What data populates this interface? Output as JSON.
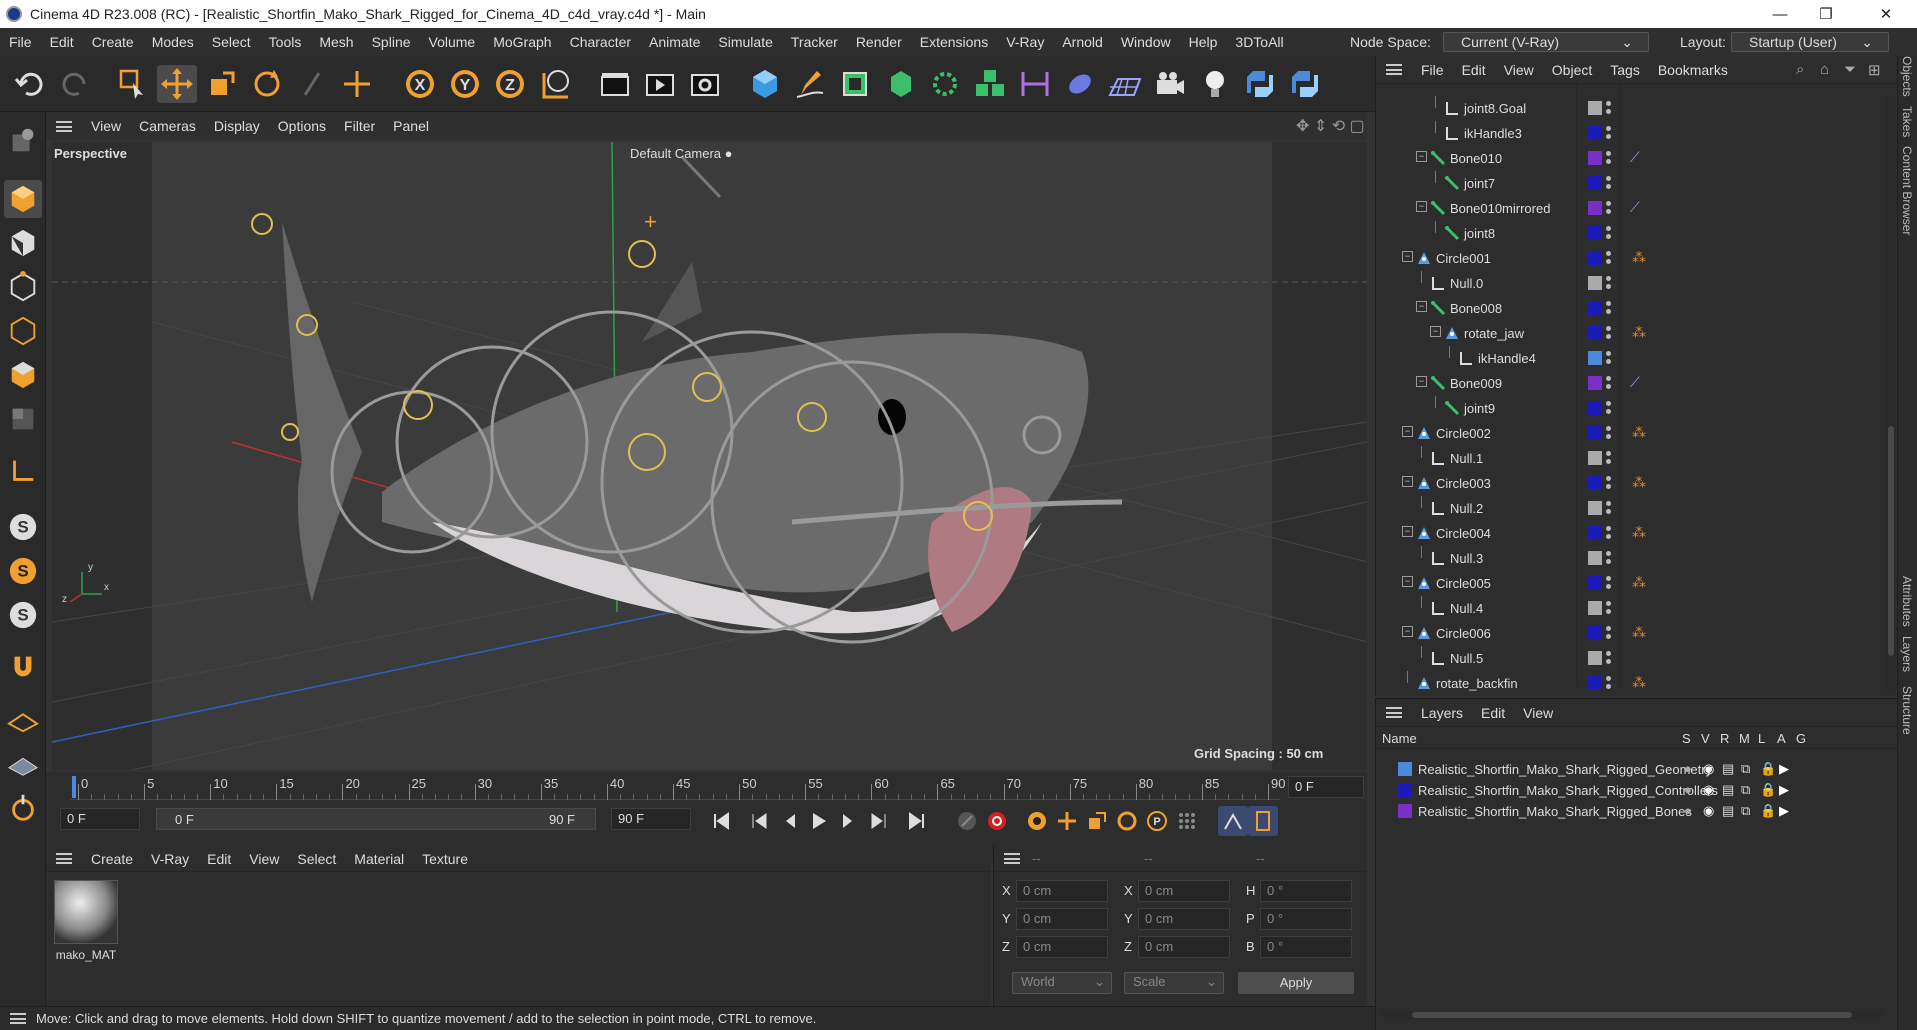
{
  "window": {
    "title": "Cinema 4D R23.008 (RC) - [Realistic_Shortfin_Mako_Shark_Rigged_for_Cinema_4D_c4d_vray.c4d *] - Main",
    "minimize": "—",
    "maximize": "❐",
    "close": "✕"
  },
  "menubar": {
    "items": [
      "File",
      "Edit",
      "Create",
      "Modes",
      "Select",
      "Tools",
      "Mesh",
      "Spline",
      "Volume",
      "MoGraph",
      "Character",
      "Animate",
      "Simulate",
      "Tracker",
      "Render",
      "Extensions",
      "V-Ray",
      "Arnold",
      "Window",
      "Help",
      "3DToAll"
    ],
    "node_space_label": "Node Space:",
    "node_space_value": "Current (V-Ray)",
    "layout_label": "Layout:",
    "layout_value": "Startup (User)"
  },
  "viewport": {
    "menu": [
      "View",
      "Cameras",
      "Display",
      "Options",
      "Filter",
      "Panel"
    ],
    "label": "Perspective",
    "camera": "Default Camera",
    "grid_spacing": "Grid Spacing : 50 cm",
    "axis_x": "x",
    "axis_y": "y",
    "axis_z": "z"
  },
  "timeline": {
    "ticks": [
      "0",
      "5",
      "10",
      "15",
      "20",
      "25",
      "30",
      "35",
      "40",
      "45",
      "50",
      "55",
      "60",
      "65",
      "70",
      "75",
      "80",
      "85",
      "90"
    ],
    "frame_display": "0 F",
    "start": "0 F",
    "range_start": "0 F",
    "range_end": "90 F",
    "end": "90 F"
  },
  "materials": {
    "menu": [
      "Create",
      "V-Ray",
      "Edit",
      "View",
      "Select",
      "Material",
      "Texture"
    ],
    "items": [
      {
        "name": "mako_MAT"
      }
    ]
  },
  "attributes": {
    "headers": [
      "--",
      "--",
      "--"
    ],
    "rows": [
      {
        "a": "X",
        "av": "0 cm",
        "b": "X",
        "bv": "0 cm",
        "c": "H",
        "cv": "0 °"
      },
      {
        "a": "Y",
        "av": "0 cm",
        "b": "Y",
        "bv": "0 cm",
        "c": "P",
        "cv": "0 °"
      },
      {
        "a": "Z",
        "av": "0 cm",
        "b": "Z",
        "bv": "0 cm",
        "c": "B",
        "cv": "0 °"
      }
    ],
    "coord_mode": "World",
    "size_mode": "Scale",
    "apply": "Apply"
  },
  "status": "Move: Click and drag to move elements. Hold down SHIFT to quantize movement / add to the selection in point mode, CTRL to remove.",
  "objects": {
    "menu": [
      "File",
      "Edit",
      "View",
      "Object",
      "Tags",
      "Bookmarks"
    ],
    "rows": [
      {
        "name": "joint8.Goal",
        "indent": 4,
        "kind": "null",
        "color": "#aaaaaa",
        "tag": "",
        "expander": false
      },
      {
        "name": "ikHandle3",
        "indent": 4,
        "kind": "null",
        "color": "#1a1ab8",
        "tag": "",
        "expander": false
      },
      {
        "name": "Bone010",
        "indent": 3,
        "kind": "bone",
        "color": "#7a2fc8",
        "tag": "ik",
        "expander": true
      },
      {
        "name": "joint7",
        "indent": 4,
        "kind": "bone",
        "color": "#1a1ab8",
        "tag": "",
        "expander": false
      },
      {
        "name": "Bone010mirrored",
        "indent": 3,
        "kind": "bone",
        "color": "#7a2fc8",
        "tag": "ik",
        "expander": true
      },
      {
        "name": "joint8",
        "indent": 4,
        "kind": "bone",
        "color": "#1a1ab8",
        "tag": "",
        "expander": false
      },
      {
        "name": "Circle001",
        "indent": 2,
        "kind": "spline",
        "color": "#1a1ab8",
        "tag": "xp",
        "expander": true
      },
      {
        "name": "Null.0",
        "indent": 3,
        "kind": "null",
        "color": "#aaaaaa",
        "tag": "",
        "expander": false
      },
      {
        "name": "Bone008",
        "indent": 3,
        "kind": "bone",
        "color": "#1a1ab8",
        "tag": "",
        "expander": true
      },
      {
        "name": "rotate_jaw",
        "indent": 4,
        "kind": "spline",
        "color": "#1a1ab8",
        "tag": "xp",
        "expander": true
      },
      {
        "name": "ikHandle4",
        "indent": 5,
        "kind": "null",
        "color": "#4a8ad8",
        "tag": "",
        "expander": false
      },
      {
        "name": "Bone009",
        "indent": 3,
        "kind": "bone",
        "color": "#7a2fc8",
        "tag": "ik2",
        "expander": true
      },
      {
        "name": "joint9",
        "indent": 4,
        "kind": "bone",
        "color": "#1a1ab8",
        "tag": "",
        "expander": false
      },
      {
        "name": "Circle002",
        "indent": 2,
        "kind": "spline",
        "color": "#1a1ab8",
        "tag": "xp",
        "expander": true
      },
      {
        "name": "Null.1",
        "indent": 3,
        "kind": "null",
        "color": "#aaaaaa",
        "tag": "",
        "expander": false
      },
      {
        "name": "Circle003",
        "indent": 2,
        "kind": "spline",
        "color": "#1a1ab8",
        "tag": "xp",
        "expander": true
      },
      {
        "name": "Null.2",
        "indent": 3,
        "kind": "null",
        "color": "#aaaaaa",
        "tag": "",
        "expander": false
      },
      {
        "name": "Circle004",
        "indent": 2,
        "kind": "spline",
        "color": "#1a1ab8",
        "tag": "xp",
        "expander": true
      },
      {
        "name": "Null.3",
        "indent": 3,
        "kind": "null",
        "color": "#aaaaaa",
        "tag": "",
        "expander": false
      },
      {
        "name": "Circle005",
        "indent": 2,
        "kind": "spline",
        "color": "#1a1ab8",
        "tag": "xp",
        "expander": true
      },
      {
        "name": "Null.4",
        "indent": 3,
        "kind": "null",
        "color": "#aaaaaa",
        "tag": "",
        "expander": false
      },
      {
        "name": "Circle006",
        "indent": 2,
        "kind": "spline",
        "color": "#1a1ab8",
        "tag": "xp",
        "expander": true
      },
      {
        "name": "Null.5",
        "indent": 3,
        "kind": "null",
        "color": "#aaaaaa",
        "tag": "",
        "expander": false
      },
      {
        "name": "rotate_backfin",
        "indent": 2,
        "kind": "spline",
        "color": "#1a1ab8",
        "tag": "xp",
        "expander": false
      }
    ]
  },
  "layers": {
    "menu": [
      "Layers",
      "Edit",
      "View"
    ],
    "col_name": "Name",
    "cols": [
      "S",
      "V",
      "R",
      "M",
      "L",
      "A",
      "G"
    ],
    "rows": [
      {
        "name": "Realistic_Shortfin_Mako_Shark_Rigged_Geometry",
        "color": "#4a8ad8"
      },
      {
        "name": "Realistic_Shortfin_Mako_Shark_Rigged_Controllers",
        "color": "#1a1ab8"
      },
      {
        "name": "Realistic_Shortfin_Mako_Shark_Rigged_Bones",
        "color": "#7a2fc8"
      }
    ]
  },
  "side_tabs": [
    "Objects",
    "Takes",
    "Content Browser",
    "Attributes",
    "Layers",
    "Structure"
  ]
}
